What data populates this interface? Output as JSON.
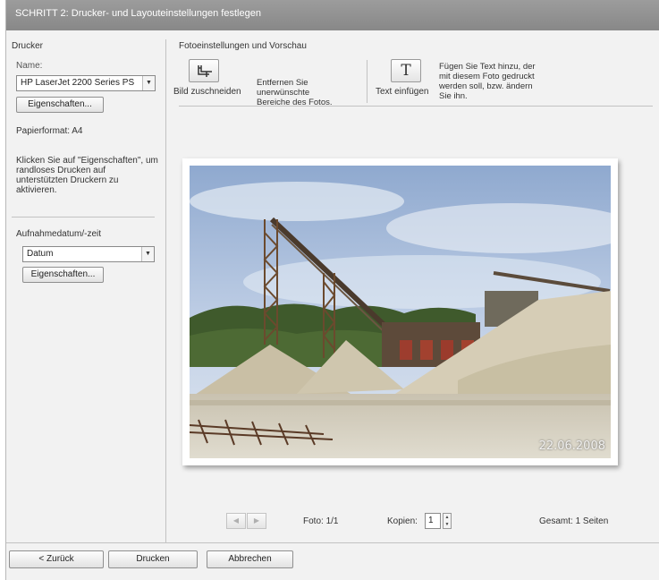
{
  "title": "SCHRITT 2: Drucker- und Layouteinstellungen festlegen",
  "printer": {
    "section_label": "Drucker",
    "name_label": "Name:",
    "selected_printer": "HP LaserJet 2200 Series PS",
    "properties_button": "Eigenschaften...",
    "paper_format": "Papierformat: A4",
    "hint": "Klicken Sie auf \"Eigenschaften\", um randloses Drucken auf unterstützten Druckern zu aktivieren."
  },
  "date_section": {
    "label": "Aufnahmedatum/-zeit",
    "selected": "Datum",
    "properties_button": "Eigenschaften..."
  },
  "photo_settings": {
    "label": "Fotoeinstellungen und Vorschau",
    "crop": {
      "label": "Bild zuschneiden",
      "description": "Entfernen Sie unerwünschte Bereiche des Fotos.",
      "icon": "crop-icon"
    },
    "text": {
      "label": "Text einfügen",
      "description": "Fügen Sie Text hinzu, der mit diesem Foto gedruckt werden soll, bzw. ändern Sie ihn.",
      "icon": "text-icon",
      "glyph": "T"
    }
  },
  "preview": {
    "date_stamp": "22.06.2008",
    "prev_glyph": "◀",
    "next_glyph": "▶",
    "photo_counter": "Foto: 1/1",
    "copies_label": "Kopien:",
    "copies_value": "1",
    "total": "Gesamt: 1 Seiten"
  },
  "buttons": {
    "back": "< Zurück",
    "print": "Drucken",
    "cancel": "Abbrechen"
  },
  "colors": {
    "title_bar": "#909090",
    "window_bg": "#f2f2f2",
    "sky": "#a9bfdc"
  }
}
